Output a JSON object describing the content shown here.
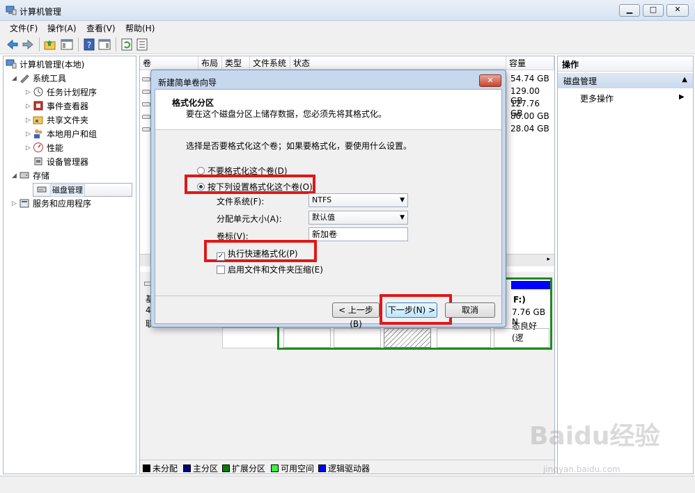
{
  "window": {
    "title": "计算机管理",
    "minimize_glyph": "▁",
    "maximize_glyph": "□",
    "close_glyph": "✕"
  },
  "menu": [
    "文件(F)",
    "操作(A)",
    "查看(V)",
    "帮助(H)"
  ],
  "tree": {
    "root": "计算机管理(本地)",
    "system_tools": "系统工具",
    "task_scheduler": "任务计划程序",
    "event_viewer": "事件查看器",
    "shared_folders": "共享文件夹",
    "local_users": "本地用户和组",
    "performance": "性能",
    "device_manager": "设备管理器",
    "storage": "存储",
    "disk_management": "磁盘管理",
    "services_apps": "服务和应用程序"
  },
  "volume_table": {
    "columns": [
      "卷",
      "布局",
      "类型",
      "文件系统",
      "状态",
      "容量"
    ],
    "capacities": [
      "54.74 GB",
      "129.00 GB",
      "127.76 GB",
      "80.00 GB",
      "28.04 GB"
    ]
  },
  "disk_view": {
    "partition_fragment_1": "F:)",
    "partition_fragment_2": "7.76 GB N",
    "partition_fragment_3": "态良好 (逻",
    "disk_label_1": "基",
    "disk_label_2": "4",
    "disk_label_3": "联"
  },
  "legend": [
    {
      "label": "未分配",
      "color": "#000000"
    },
    {
      "label": "主分区",
      "color": "#00007f"
    },
    {
      "label": "扩展分区",
      "color": "#007f00"
    },
    {
      "label": "可用空间",
      "color": "#33ff33"
    },
    {
      "label": "逻辑驱动器",
      "color": "#0000ff"
    }
  ],
  "actions": {
    "header": "操作",
    "section": "磁盘管理",
    "more": "更多操作"
  },
  "wizard": {
    "title": "新建简单卷向导",
    "close_glyph": "✕",
    "heading": "格式化分区",
    "subheading": "要在这个磁盘分区上储存数据，您必须先将其格式化。",
    "question": "选择是否要格式化这个卷；如果要格式化，要使用什么设置。",
    "option_no_format": "不要格式化这个卷(D)",
    "option_format": "按下列设置格式化这个卷(O)",
    "file_system_label": "文件系统(F):",
    "file_system_value": "NTFS",
    "alloc_label": "分配单元大小(A):",
    "alloc_value": "默认值",
    "volume_label_label": "卷标(V):",
    "volume_label_value": "新加卷",
    "quick_format": "执行快速格式化(P)",
    "compression": "启用文件和文件夹压缩(E)",
    "back": "< 上一步(B)",
    "next": "下一步(N) >",
    "cancel": "取消"
  },
  "watermark": {
    "brand": "Baidu经验",
    "url": "jingyan.baidu.com"
  },
  "accent_colors": {
    "highlight_red": "#e01818",
    "selection_blue": "#e5eef8"
  }
}
